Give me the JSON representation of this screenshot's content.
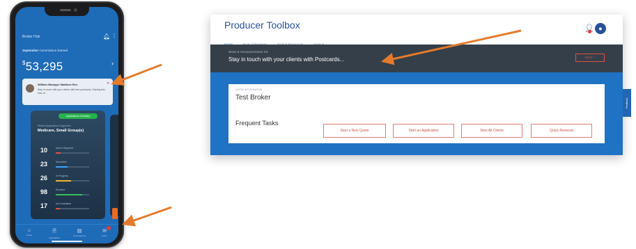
{
  "phone": {
    "header_title": "Broker Hub",
    "subtitle_bold": "September",
    "subtitle_rest": " Commission Earned",
    "amount_currency": "$",
    "amount": "53,295",
    "message": {
      "title": "William Manager Matthew Rex",
      "body": "Stay in touch with your clients with free postcards. Starting this time of..."
    },
    "tile": {
      "pill": "Applications Summary",
      "label": "Market Applications Supported",
      "heading": "Medicare, Small Group(s)",
      "rows": [
        {
          "num": "10",
          "label": "Action Required",
          "fill": 0.15,
          "color": "#e5533d"
        },
        {
          "num": "23",
          "label": "Submitted",
          "fill": 0.35,
          "color": "#3fa3ff"
        },
        {
          "num": "26",
          "label": "In Progress",
          "fill": 0.45,
          "color": "#f2b632"
        },
        {
          "num": "98",
          "label": "Enrolled",
          "fill": 0.8,
          "color": "#36c05a"
        },
        {
          "num": "17",
          "label": "Not Submitted",
          "fill": 0.12,
          "color": "#e5533d"
        }
      ]
    },
    "nav": [
      {
        "icon": "home-icon",
        "label": "Home"
      },
      {
        "icon": "document-icon",
        "label": "Applications"
      },
      {
        "icon": "briefcase-icon",
        "label": "Commissions"
      },
      {
        "icon": "mail-icon",
        "label": "Inbox"
      }
    ]
  },
  "desktop": {
    "brand": "Producer Toolbox",
    "nav": [
      "Home",
      "Book of Business",
      "Tools & Resources",
      "Support"
    ],
    "news_label": "News & Announcements 1/3",
    "news_text": "Stay in touch with your clients with Postcards...",
    "more_label": "More +",
    "greeting": "GOOD AFTERNOON",
    "user_name": "Test Broker",
    "frequent_tasks": "Frequent Tasks",
    "tasks": [
      "Start a New Quote",
      "Start an Application",
      "View All Clients",
      "Quick Renewal"
    ],
    "feedback": "Feedback"
  },
  "colors": {
    "primary_blue": "#1f72c4",
    "dark_bar": "#353f4a",
    "brand_text": "#29529a",
    "arrow_orange": "#e57a2c",
    "button_outline": "#e07d75"
  }
}
